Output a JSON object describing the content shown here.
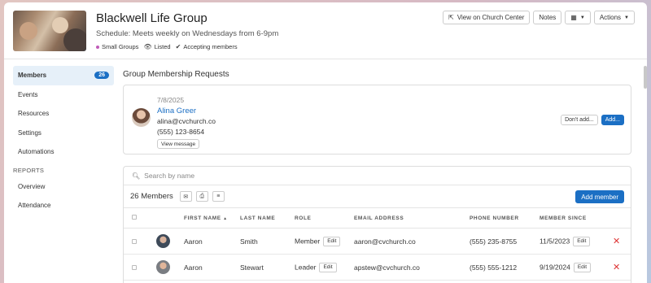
{
  "header": {
    "title": "Blackwell Life Group",
    "schedule": "Schedule: Meets weekly on Wednesdays from 6-9pm",
    "tags": [
      "Small Groups",
      "Listed",
      "Accepting members"
    ],
    "buttons": {
      "view_center": "View on Church Center",
      "notes": "Notes",
      "actions": "Actions"
    }
  },
  "sidebar": {
    "items": [
      {
        "label": "Members",
        "badge": "26"
      },
      {
        "label": "Events"
      },
      {
        "label": "Resources"
      },
      {
        "label": "Settings"
      },
      {
        "label": "Automations"
      }
    ],
    "reports_heading": "REPORTS",
    "reports": [
      {
        "label": "Overview"
      },
      {
        "label": "Attendance"
      }
    ]
  },
  "requests": {
    "title": "Group Membership Requests",
    "item": {
      "date": "7/8/2025",
      "name": "Alina Greer",
      "email": "alina@cvchurch.co",
      "phone": "(555) 123-8654",
      "view_message": "View message",
      "dont_add": "Don't add...",
      "add": "Add..."
    }
  },
  "members": {
    "search_placeholder": "Search by name",
    "count": "26 Members",
    "add_member": "Add member",
    "columns": [
      "FIRST NAME",
      "LAST NAME",
      "ROLE",
      "EMAIL ADDRESS",
      "PHONE NUMBER",
      "MEMBER SINCE"
    ],
    "edit_label": "Edit",
    "rows": [
      {
        "first": "Aaron",
        "last": "Smith",
        "role": "Member",
        "email": "aaron@cvchurch.co",
        "phone": "(555) 235-8755",
        "since": "11/5/2023"
      },
      {
        "first": "Aaron",
        "last": "Stewart",
        "role": "Leader",
        "email": "apstew@cvchurch.co",
        "phone": "(555) 555-1212",
        "since": "9/19/2024"
      }
    ]
  },
  "colors": {
    "accent": "#1b6fc4",
    "danger": "#dd3333",
    "active_bg": "#e6f0f9",
    "tag_dot": "#c05bb8"
  },
  "icons": [
    "external-link-icon",
    "calendar-icon",
    "caret-down-icon",
    "eye-icon",
    "check-icon",
    "search-icon",
    "mail-icon",
    "print-icon",
    "filter-icon",
    "delete-icon",
    "sort-asc-icon"
  ]
}
